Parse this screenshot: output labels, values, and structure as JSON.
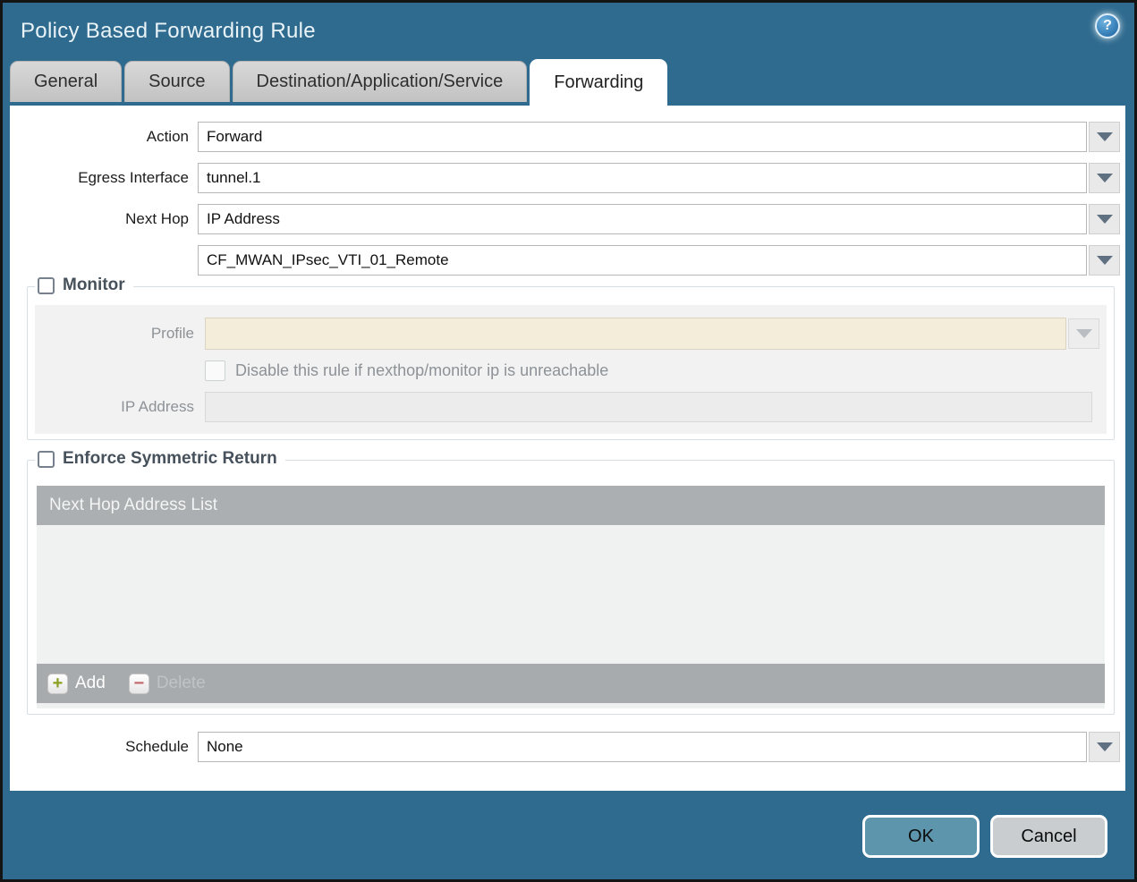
{
  "dialog": {
    "title": "Policy Based Forwarding Rule",
    "help_icon": "?"
  },
  "tabs": [
    {
      "label": "General",
      "active": false
    },
    {
      "label": "Source",
      "active": false
    },
    {
      "label": "Destination/Application/Service",
      "active": false
    },
    {
      "label": "Forwarding",
      "active": true
    }
  ],
  "form": {
    "action": {
      "label": "Action",
      "value": "Forward"
    },
    "egress_interface": {
      "label": "Egress Interface",
      "value": "tunnel.1"
    },
    "next_hop": {
      "label": "Next Hop",
      "value": "IP Address"
    },
    "next_hop_address": {
      "value": "CF_MWAN_IPsec_VTI_01_Remote"
    },
    "schedule": {
      "label": "Schedule",
      "value": "None"
    }
  },
  "monitor": {
    "legend": "Monitor",
    "checked": false,
    "profile": {
      "label": "Profile",
      "value": ""
    },
    "disable_rule": {
      "label": "Disable this rule if nexthop/monitor ip is unreachable",
      "checked": false
    },
    "ip_address": {
      "label": "IP Address",
      "value": ""
    }
  },
  "symmetric_return": {
    "legend": "Enforce Symmetric Return",
    "checked": false,
    "table_header": "Next Hop Address List",
    "rows": [],
    "add_label": "Add",
    "delete_label": "Delete",
    "add_icon": "+",
    "delete_icon": "−"
  },
  "footer": {
    "ok_label": "OK",
    "cancel_label": "Cancel"
  },
  "colors": {
    "chrome_teal": "#2f6b8f",
    "ok_button": "#5d95ac",
    "cancel_button": "#c9cdd0",
    "table_header": "#abafb1",
    "disabled_field_cream": "#f4edda",
    "add_plus_green": "#8ba021",
    "delete_minus_red": "#c4686e"
  }
}
